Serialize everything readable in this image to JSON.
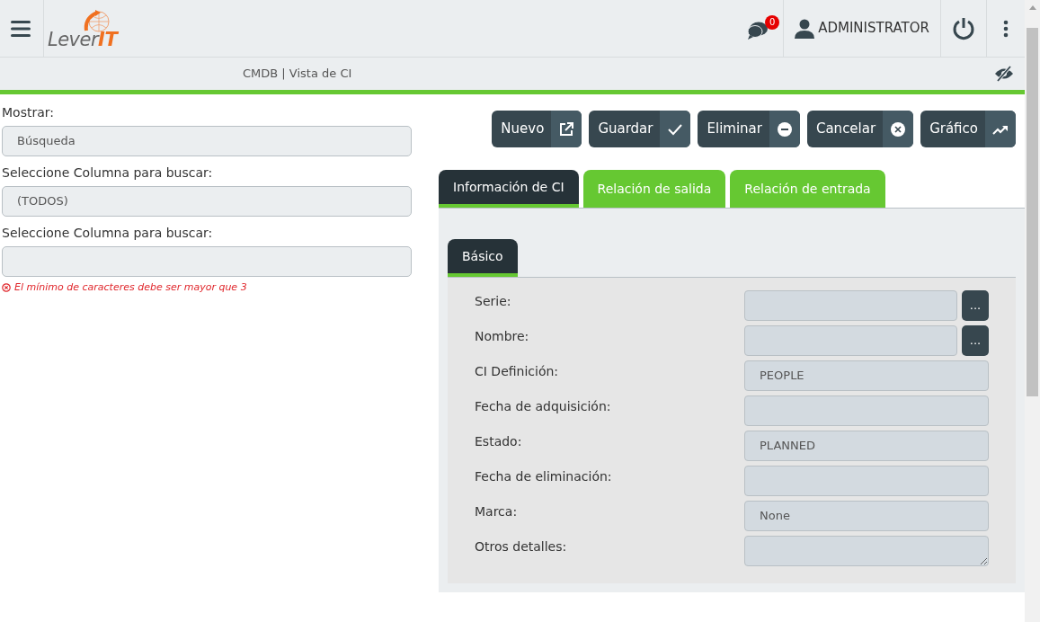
{
  "header": {
    "logo": {
      "word": "Lever",
      "suffix": "IT"
    },
    "notifications": {
      "count": "0"
    },
    "user": "ADMINISTRATOR"
  },
  "breadcrumb": "CMDB | Vista de CI",
  "search": {
    "show_label": "Mostrar:",
    "show_value": "Búsqueda",
    "column_label": "Seleccione Columna para buscar:",
    "column_value": "(TODOS)",
    "text_label": "Seleccione Columna para buscar:",
    "error": "El mínimo de caracteres debe ser mayor que 3"
  },
  "actions": [
    {
      "label": "Nuevo",
      "kind": "new"
    },
    {
      "label": "Guardar",
      "kind": "save"
    },
    {
      "label": "Eliminar",
      "kind": "delete"
    },
    {
      "label": "Cancelar",
      "kind": "cancel"
    },
    {
      "label": "Gráfico",
      "kind": "chart"
    }
  ],
  "tabs": [
    {
      "label": "Información de CI",
      "selected": true
    },
    {
      "label": "Relación de salida",
      "selected": false
    },
    {
      "label": "Relación de entrada",
      "selected": false
    }
  ],
  "subtabs": [
    {
      "label": "Básico",
      "selected": true
    }
  ],
  "fields": [
    {
      "label": "Serie:",
      "kind": "lookup",
      "button": "..."
    },
    {
      "label": "Nombre:",
      "kind": "lookup",
      "button": "..."
    },
    {
      "label": "CI Definición:",
      "kind": "select",
      "value": "PEOPLE"
    },
    {
      "label": "Fecha de adquisición:",
      "kind": "text"
    },
    {
      "label": "Estado:",
      "kind": "select",
      "value": "PLANNED"
    },
    {
      "label": "Fecha de eliminación:",
      "kind": "text"
    },
    {
      "label": "Marca:",
      "kind": "select",
      "value": "None"
    },
    {
      "label": "Otros detalles:",
      "kind": "textarea"
    }
  ]
}
